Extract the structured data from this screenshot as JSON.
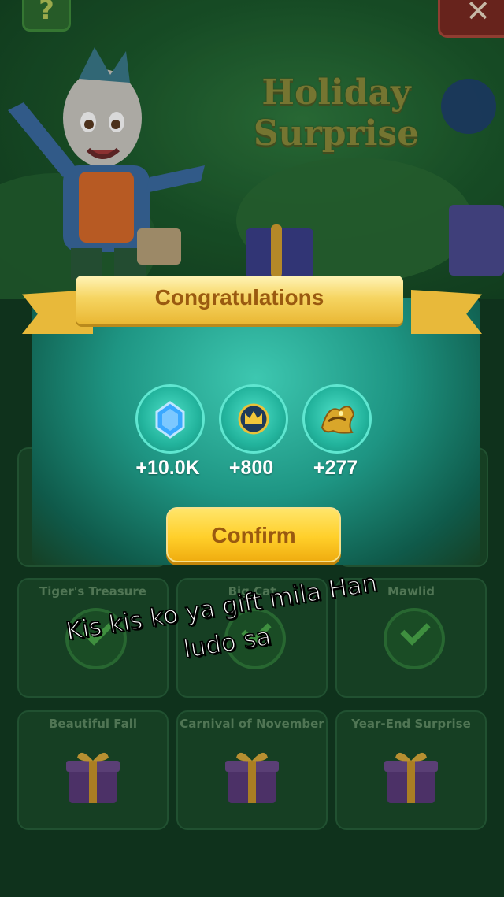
{
  "event": {
    "title": "Holiday Surprise",
    "help_label": "?",
    "close_label": "✕"
  },
  "event_cards": [
    {
      "title": "",
      "status": "claimed"
    },
    {
      "title": "",
      "status": "claimed"
    },
    {
      "title": "Tiger's Treasure",
      "status": "claimed"
    },
    {
      "title": "Big Cat",
      "status": "claimed"
    },
    {
      "title": "Mawlid",
      "status": "claimed"
    },
    {
      "title": "Beautiful Fall",
      "status": "gift"
    },
    {
      "title": "Carnival of November",
      "status": "gift"
    },
    {
      "title": "Year-End Surprise",
      "status": "gift"
    }
  ],
  "popup": {
    "title": "Congratulations",
    "rewards": [
      {
        "icon": "diamond-icon",
        "value": "+10.0K"
      },
      {
        "icon": "crown-icon",
        "value": "+800"
      },
      {
        "icon": "golden-ornament-icon",
        "value": "+277"
      }
    ],
    "confirm_label": "Confirm"
  },
  "caption": {
    "line1": "Kis kis ko ya gift mila Han",
    "line2": "ludo sa"
  },
  "colors": {
    "popup_teal": "#1e9583",
    "ribbon_gold": "#f6d562",
    "button_yellow": "#ffcf2a",
    "label_brown": "#9a5a10"
  }
}
